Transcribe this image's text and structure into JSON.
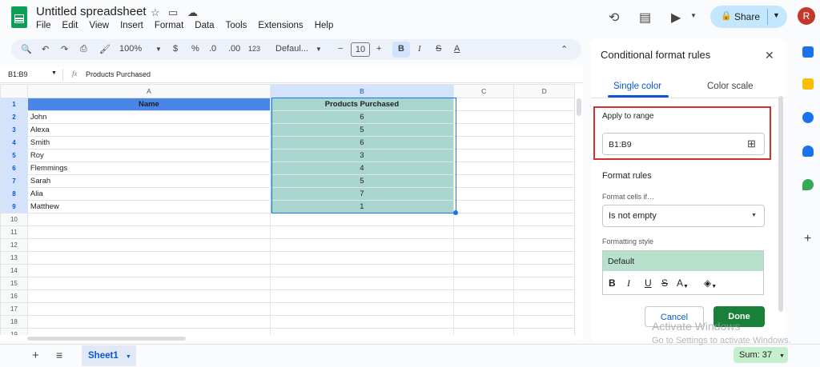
{
  "app": {
    "title": "Untitled spreadsheet",
    "avatar_letter": "R",
    "share_label": "Share"
  },
  "menu": [
    "File",
    "Edit",
    "View",
    "Insert",
    "Format",
    "Data",
    "Tools",
    "Extensions",
    "Help"
  ],
  "toolbar": {
    "zoom": "100%",
    "currency": "$",
    "percent": "%",
    "dec_dec": ".0",
    "dec_inc": ".00",
    "num_fmt": "123",
    "font": "Defaul...",
    "font_size": "10"
  },
  "formula": {
    "name_box": "B1:B9",
    "fx": "fx",
    "content": "Products Purchased"
  },
  "grid": {
    "columns": [
      "A",
      "B",
      "C",
      "D"
    ],
    "rows": [
      "1",
      "2",
      "3",
      "4",
      "5",
      "6",
      "7",
      "8",
      "9",
      "10",
      "11",
      "12",
      "13",
      "14",
      "15",
      "16",
      "17",
      "18",
      "19"
    ],
    "header": {
      "a": "Name",
      "b": "Products Purchased"
    },
    "data": [
      {
        "name": "John",
        "val": "6"
      },
      {
        "name": "Alexa",
        "val": "5"
      },
      {
        "name": "Smith",
        "val": "6"
      },
      {
        "name": "Roy",
        "val": "3"
      },
      {
        "name": "Flemmings",
        "val": "4"
      },
      {
        "name": "Sarah",
        "val": "5"
      },
      {
        "name": "Alia",
        "val": "7"
      },
      {
        "name": "Matthew",
        "val": "1"
      }
    ]
  },
  "bottom": {
    "sheet": "Sheet1",
    "sum": "Sum: 37"
  },
  "panel": {
    "title": "Conditional format rules",
    "tab_single": "Single color",
    "tab_scale": "Color scale",
    "apply_label": "Apply to range",
    "range": "B1:B9",
    "format_rules": "Format rules",
    "cells_if_label": "Format cells if…",
    "condition": "Is not empty",
    "style_label": "Formatting style",
    "preview": "Default",
    "cancel": "Cancel",
    "done": "Done"
  },
  "watermark": {
    "line1": "Activate Windows",
    "line2": "Go to Settings to activate Windows."
  },
  "colors": {
    "header_fill": "#4a86e8",
    "range_fill": "#a8d5cd",
    "done_green": "#188038",
    "highlight_red": "#d32f2f"
  }
}
